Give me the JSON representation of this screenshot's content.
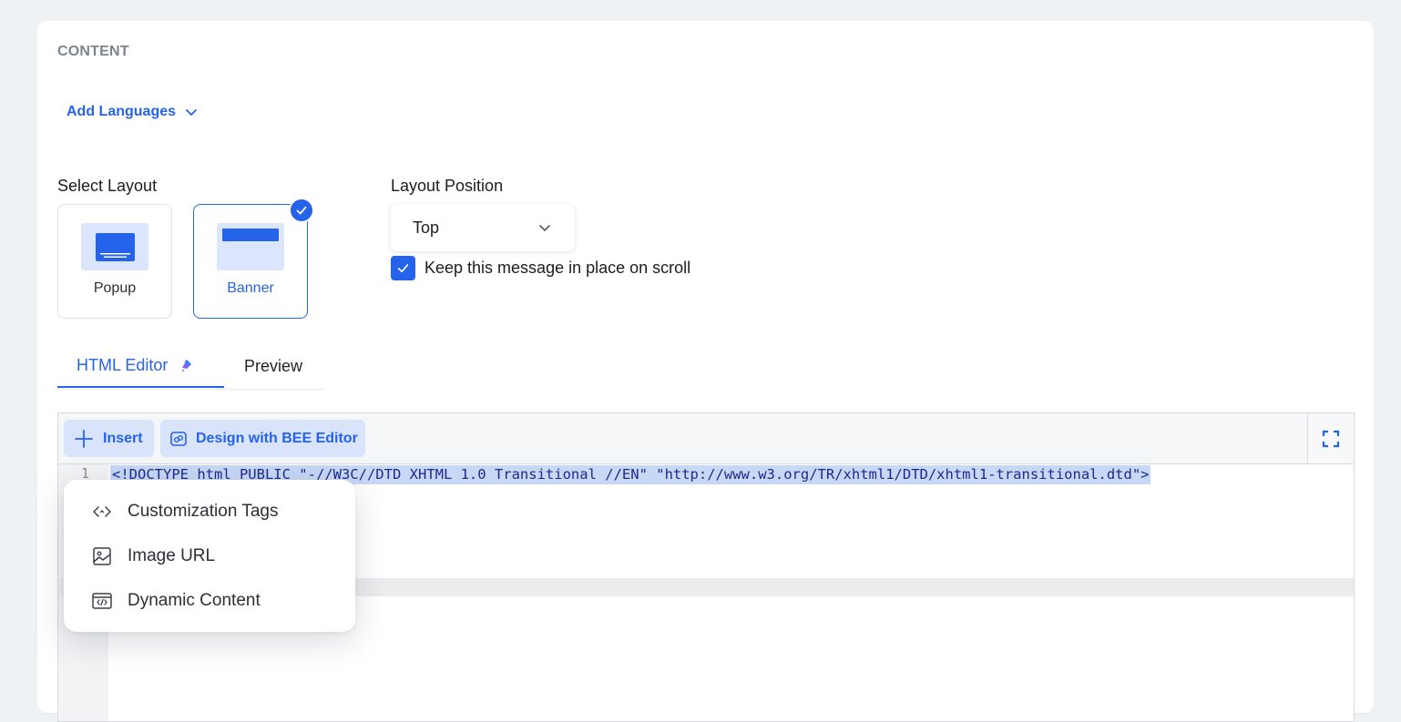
{
  "content": {
    "section_title": "CONTENT",
    "add_languages": "Add Languages"
  },
  "layout": {
    "select_label": "Select Layout",
    "options": [
      {
        "label": "Popup",
        "selected": false
      },
      {
        "label": "Banner",
        "selected": true
      }
    ]
  },
  "position": {
    "label": "Layout Position",
    "value": "Top"
  },
  "keep_in_place": {
    "label": "Keep this message in place on scroll",
    "checked": true
  },
  "tabs": [
    {
      "label": "HTML Editor",
      "active": true
    },
    {
      "label": "Preview",
      "active": false
    }
  ],
  "toolbar": {
    "insert_label": "Insert",
    "bee_label": "Design with BEE Editor"
  },
  "editor": {
    "line_number": "1",
    "code": "<!DOCTYPE html PUBLIC \"-//W3C//DTD XHTML 1.0 Transitional //EN\" \"http://www.w3.org/TR/xhtml1/DTD/xhtml1-transitional.dtd\">"
  },
  "insert_menu": {
    "items": [
      {
        "label": "Customization Tags",
        "icon": "code-tag-icon"
      },
      {
        "label": "Image URL",
        "icon": "image-icon"
      },
      {
        "label": "Dynamic Content",
        "icon": "code-window-icon"
      }
    ]
  },
  "colors": {
    "accent": "#2563eb",
    "accent_light": "#d9e3f9",
    "background": "#eff2f5"
  }
}
